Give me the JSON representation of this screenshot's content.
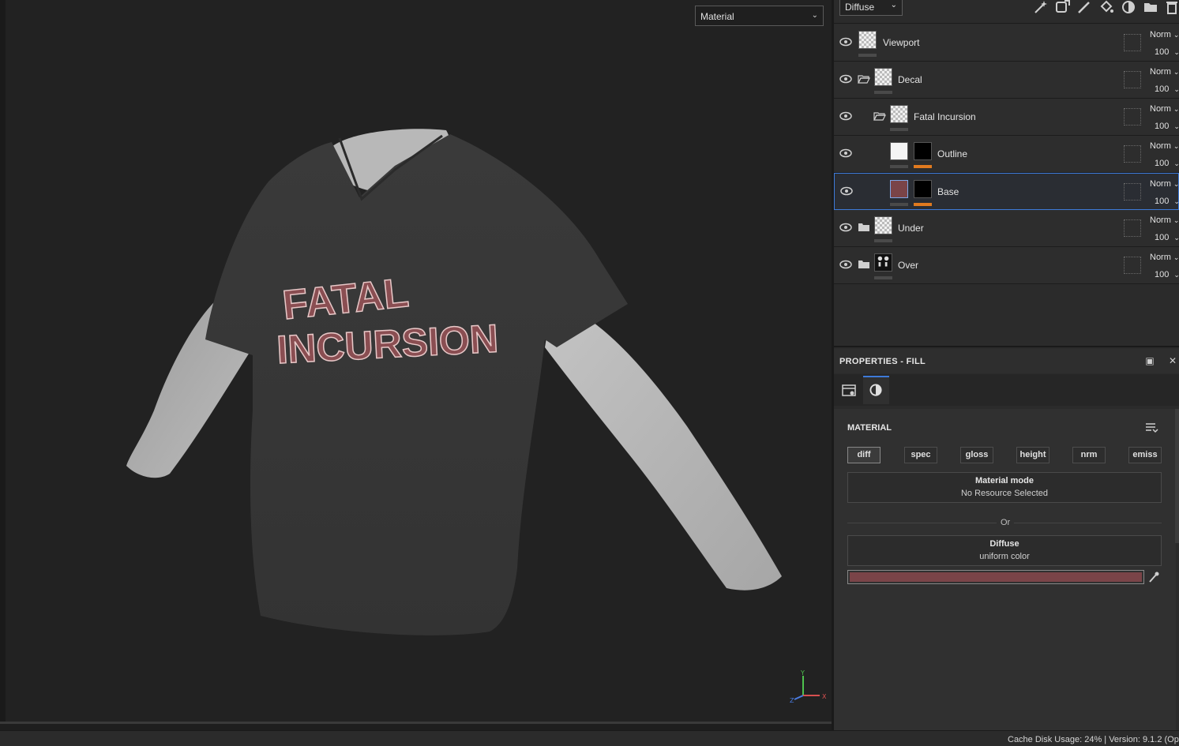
{
  "viewport": {
    "material_dropdown": "Material",
    "gizmo_axes": {
      "y": "Y",
      "x": "X",
      "z": "Z"
    },
    "print_text": "FATAL INCURSION"
  },
  "layers_toolbar": {
    "channel": "Diffuse",
    "tools": [
      "magic-wand-icon",
      "add-effect-icon",
      "brush-icon",
      "fill-bucket-icon",
      "material-ball-icon",
      "folder-icon",
      "trash-icon"
    ]
  },
  "layers": [
    {
      "name": "Viewport",
      "blend": "Norm",
      "opacity": "100"
    },
    {
      "name": "Decal",
      "blend": "Norm",
      "opacity": "100"
    },
    {
      "name": "Fatal Incursion",
      "blend": "Norm",
      "opacity": "100"
    },
    {
      "name": "Outline",
      "blend": "Norm",
      "opacity": "100"
    },
    {
      "name": "Base",
      "blend": "Norm",
      "opacity": "100"
    },
    {
      "name": "Under",
      "blend": "Norm",
      "opacity": "100"
    },
    {
      "name": "Over",
      "blend": "Norm",
      "opacity": "100"
    }
  ],
  "properties": {
    "title": "PROPERTIES - FILL",
    "section": "MATERIAL",
    "channels": [
      "diff",
      "spec",
      "gloss",
      "height",
      "nrm",
      "emiss"
    ],
    "material_mode_label": "Material mode",
    "material_mode_value": "No Resource Selected",
    "or_label": "Or",
    "diffuse_label": "Diffuse",
    "diffuse_value": "uniform color",
    "color": "#7a4448"
  },
  "status": {
    "text": "Cache Disk Usage:   24% | Version: 9.1.2 (Op"
  }
}
